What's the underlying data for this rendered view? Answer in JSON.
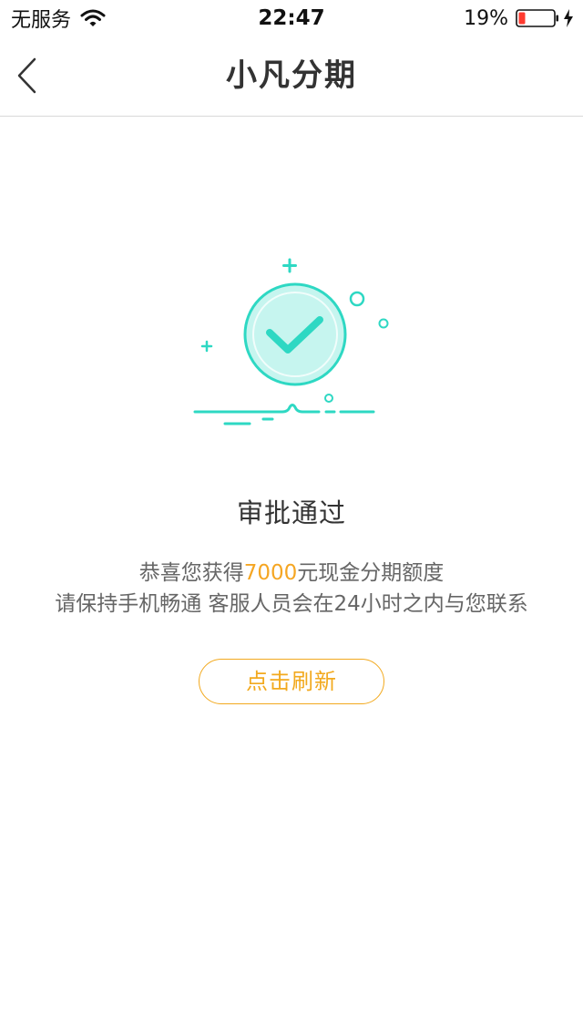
{
  "status_bar": {
    "carrier": "无服务",
    "time": "22:47",
    "battery_percent": "19%",
    "battery_level": 0.19,
    "icons": [
      "wifi-icon",
      "battery-icon",
      "charging-bolt-icon"
    ]
  },
  "nav": {
    "title": "小凡分期",
    "back_icon": "chevron-left-icon"
  },
  "illustration": {
    "icon": "check-circle-icon",
    "accent_color": "#2ed8c3",
    "fill_color": "#c6f5ef"
  },
  "result": {
    "title": "审批通过",
    "message_prefix": "恭喜您获得",
    "amount": "7000",
    "message_suffix": "元现金分期额度",
    "message_line2": "请保持手机畅通 客服人员会在24小时之内与您联系",
    "amount_color": "#f5a623"
  },
  "actions": {
    "refresh_label": "点击刷新",
    "button_color": "#f2a91e"
  }
}
